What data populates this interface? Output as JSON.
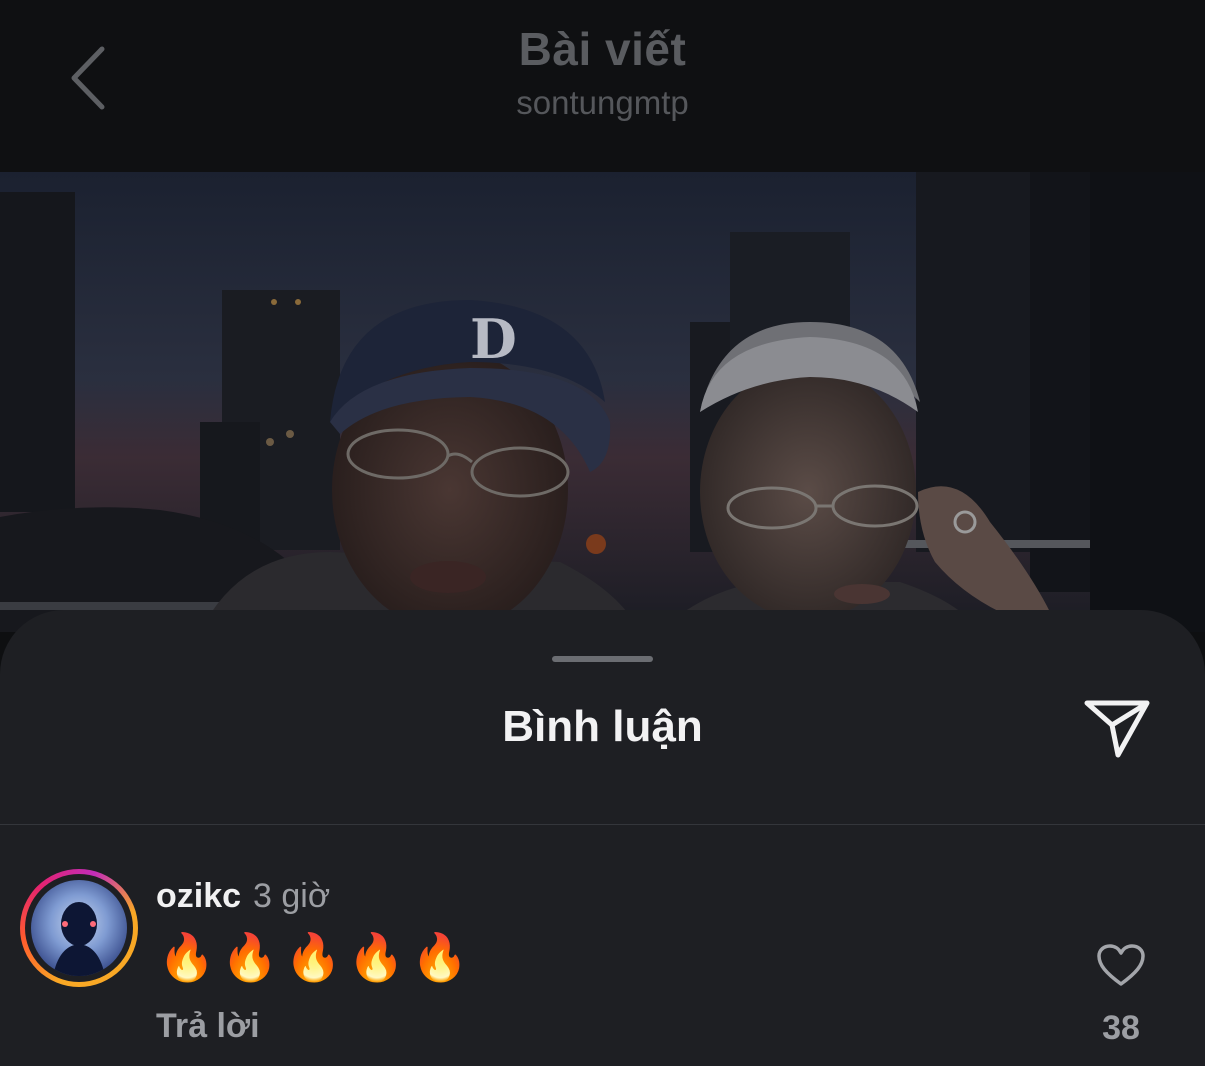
{
  "header": {
    "title": "Bài viết",
    "subtitle": "sontungmtp",
    "back_icon": "chevron-left-icon"
  },
  "post": {
    "image_icon": "photo",
    "cap_letter": "D"
  },
  "comments_sheet": {
    "title": "Bình luận",
    "share_icon": "paper-plane-icon",
    "comments": [
      {
        "username": "ozikc",
        "time": "3 giờ",
        "text": "🔥🔥🔥🔥🔥",
        "reply_label": "Trả lời",
        "like_count": "38",
        "like_icon": "heart-outline-icon",
        "avatar_ring": "story-ring"
      }
    ]
  },
  "colors": {
    "background": "#0e0f11",
    "sheet": "#1e1f23",
    "text_primary": "#f1f1f2",
    "text_secondary": "#9c9ea3"
  }
}
